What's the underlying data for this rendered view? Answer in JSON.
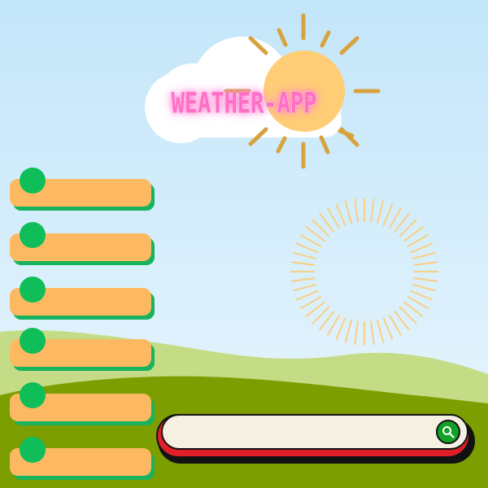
{
  "app": {
    "title": "WEATHER-APP"
  },
  "forecast_slots": [
    {
      "label": ""
    },
    {
      "label": ""
    },
    {
      "label": ""
    },
    {
      "label": ""
    },
    {
      "label": ""
    },
    {
      "label": ""
    }
  ],
  "search": {
    "value": "",
    "placeholder": "",
    "button_icon": "search-icon"
  },
  "colors": {
    "sky_top": "#c3e6fa",
    "sky_bottom": "#eaf6fd",
    "hill_light": "#c4dc86",
    "hill_dark": "#7d9e00",
    "sun": "#ffcd75",
    "sun_rays": "#d8a23e",
    "slot_fill": "#fdb961",
    "slot_accent": "#0fbe59",
    "search_frame": "#e01f27",
    "search_field": "#f5f0e1",
    "search_button": "#12a127",
    "title_glow": "#ff6fc5"
  }
}
